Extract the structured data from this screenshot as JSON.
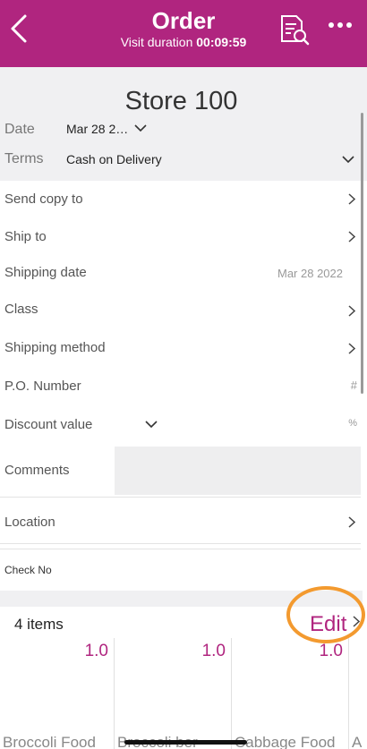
{
  "header": {
    "title": "Order",
    "visit_label": "Visit duration",
    "visit_duration": "00:09:59"
  },
  "store": {
    "name": "Store 100"
  },
  "date": {
    "label": "Date",
    "value": "Mar 28 2…"
  },
  "terms": {
    "label": "Terms",
    "value": "Cash on Delivery"
  },
  "fields": {
    "send_copy": "Send copy to",
    "ship_to": "Ship to",
    "shipping_date": "Shipping date",
    "shipping_date_value": "Mar 28 2022",
    "class": "Class",
    "shipping_method": "Shipping method",
    "po_number": "P.O. Number",
    "po_hint": "#",
    "discount": "Discount value",
    "discount_hint": "%",
    "comments": "Comments",
    "location": "Location",
    "check_no": "Check No"
  },
  "items": {
    "count_label": "4 items",
    "edit_label": "Edit",
    "cards": [
      {
        "qty": "1.0",
        "name": "Broccoli Food"
      },
      {
        "qty": "1.0",
        "name": "Broccoli ber"
      },
      {
        "qty": "1.0",
        "name": "Cabbage Food"
      },
      {
        "qty": "",
        "name": "A"
      }
    ]
  },
  "colors": {
    "brand": "#b0257f",
    "highlight": "#f39a2f"
  },
  "icons": [
    "back-chevron-icon",
    "document-search-icon",
    "more-icon",
    "chevron-down-icon",
    "chevron-right-icon"
  ]
}
